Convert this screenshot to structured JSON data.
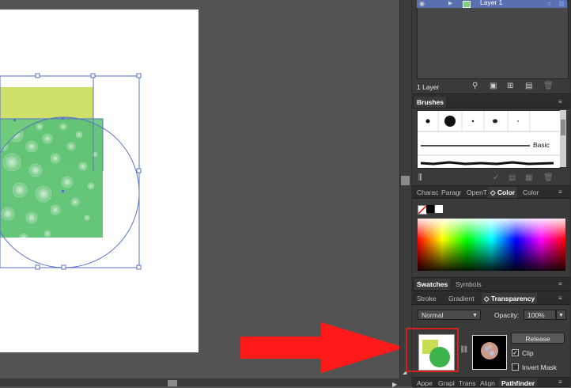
{
  "layers": {
    "layer_name": "Layer 1",
    "count_label": "1 Layer"
  },
  "brushes": {
    "tab": "Brushes",
    "basic_label": "Basic"
  },
  "color_panel": {
    "tabs": [
      "Charac",
      "Paragr",
      "OpenT",
      "◇ Color",
      "Color"
    ]
  },
  "swatches_panel": {
    "tabs": [
      "Swatches",
      "Symbols"
    ]
  },
  "transparency_panel": {
    "tabs": [
      "Stroke",
      "Gradient",
      "◇ Transparency"
    ],
    "blend_mode": "Normal",
    "opacity_label": "Opacity:",
    "opacity_value": "100%",
    "release_label": "Release",
    "clip_label": "Clip",
    "clip_checked": true,
    "invert_mask_label": "Invert Mask",
    "invert_mask_checked": false
  },
  "bottom_tabs": [
    "Appe",
    "Grapl",
    "Trans",
    "Align",
    "Pathfinder"
  ],
  "colors": {
    "selection": "#5a6fc8",
    "arrow": "#ff1a1a",
    "highlight_box": "#d42020",
    "yellow_green": "#c9dc52",
    "green": "#3cb44b"
  }
}
